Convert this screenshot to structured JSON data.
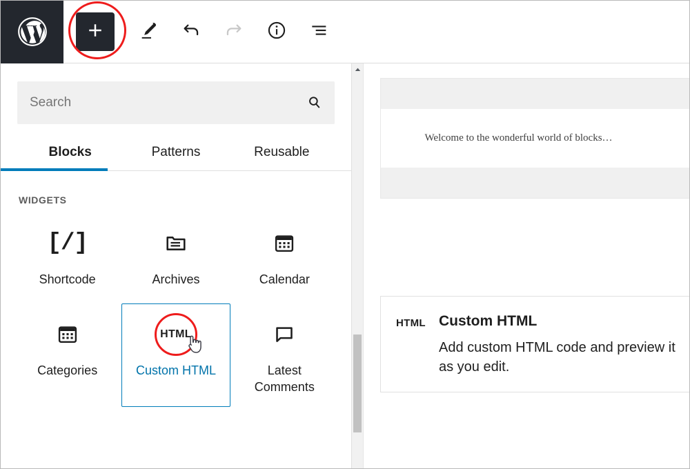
{
  "app": {
    "name": "WordPress Block Editor",
    "logo_icon": "wordpress-logo-icon"
  },
  "toolbar": {
    "inserter": {
      "label": "+",
      "icon": "plus-icon",
      "name": "Toggle block inserter"
    },
    "buttons": [
      {
        "id": "edit",
        "icon": "pencil-icon",
        "label": "Edit",
        "state": "active"
      },
      {
        "id": "undo",
        "icon": "undo-icon",
        "label": "Undo",
        "state": "enabled"
      },
      {
        "id": "redo",
        "icon": "redo-icon",
        "label": "Redo",
        "state": "disabled"
      },
      {
        "id": "details",
        "icon": "info-circle-icon",
        "label": "Details",
        "state": "enabled"
      },
      {
        "id": "list-view",
        "icon": "list-view-icon",
        "label": "List view",
        "state": "enabled"
      }
    ]
  },
  "inserter_panel": {
    "search": {
      "placeholder": "Search",
      "value": "",
      "icon": "search-icon"
    },
    "tabs": [
      {
        "id": "blocks",
        "label": "Blocks",
        "active": true
      },
      {
        "id": "patterns",
        "label": "Patterns",
        "active": false
      },
      {
        "id": "reusable",
        "label": "Reusable",
        "active": false
      }
    ],
    "section_title": "WIDGETS",
    "blocks": [
      {
        "id": "shortcode",
        "label": "Shortcode",
        "icon": "shortcode-icon",
        "glyph": "[/]",
        "selected": false
      },
      {
        "id": "archives",
        "label": "Archives",
        "icon": "archives-folder-icon",
        "selected": false
      },
      {
        "id": "calendar",
        "label": "Calendar",
        "icon": "calendar-icon",
        "selected": false
      },
      {
        "id": "categories",
        "label": "Categories",
        "icon": "categories-icon",
        "selected": false
      },
      {
        "id": "custom-html",
        "label": "Custom HTML",
        "icon": "html-icon",
        "glyph": "HTML",
        "selected": true
      },
      {
        "id": "latest-comments",
        "label": "Latest Comments",
        "icon": "comment-bubble-icon",
        "selected": false
      }
    ]
  },
  "editor_canvas": {
    "welcome_text": "Welcome to the wonderful world of blocks…"
  },
  "block_preview": {
    "icon_glyph": "HTML",
    "title": "Custom HTML",
    "description": "Add custom HTML code and preview it as you edit."
  },
  "annotations": {
    "inserter_highlight": "red-circle-annotation",
    "html_block_highlight": "red-circle-annotation",
    "cursor": "hand-pointer-cursor"
  },
  "colors": {
    "accent_blue": "#007cba",
    "link_blue": "#0073aa",
    "annotation_red": "#ee1c1c",
    "admin_dark": "#23272e",
    "panel_gray": "#f0f0f0"
  }
}
